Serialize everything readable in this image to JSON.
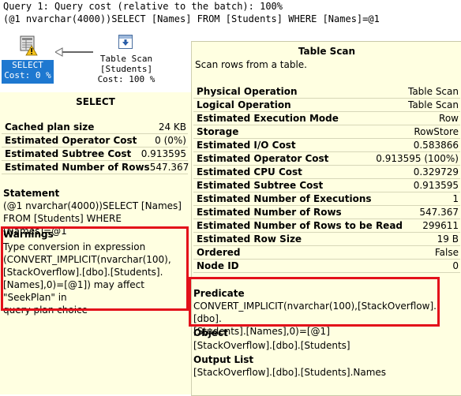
{
  "header": {
    "line1": "Query 1: Query cost (relative to the batch): 100%",
    "line2": "(@1 nvarchar(4000))SELECT [Names] FROM [Students] WHERE [Names]=@1"
  },
  "plan": {
    "select_node": {
      "label1": "SELECT",
      "label2": "Cost: 0 %",
      "icon": "select-warning-icon"
    },
    "scan_node": {
      "line1": "Table Scan",
      "line2": "[Students]",
      "line3": "Cost: 100 %",
      "icon": "table-scan-icon"
    }
  },
  "select_tooltip": {
    "title": "SELECT",
    "rows": [
      {
        "label": "Cached plan size",
        "value": "24 KB"
      },
      {
        "label": "Estimated Operator Cost",
        "value": "0 (0%)"
      },
      {
        "label": "Estimated Subtree Cost",
        "value": "0.913595"
      },
      {
        "label": "Estimated Number of Rows",
        "value": "547.367"
      }
    ],
    "statement_title": "Statement",
    "statement_line1": "(@1 nvarchar(4000))SELECT [Names]",
    "statement_line2": "FROM [Students] WHERE [Names]=@1",
    "warnings_title": "Warnings",
    "warnings_lines": [
      "Type conversion in expression",
      "(CONVERT_IMPLICIT(nvarchar(100),",
      "[StackOverflow].[dbo].[Students].",
      "[Names],0)=[@1]) may affect \"SeekPlan\" in",
      "query plan choice"
    ]
  },
  "scan_tooltip": {
    "title": "Table Scan",
    "description": "Scan rows from a table.",
    "rows": [
      {
        "label": "Physical Operation",
        "value": "Table Scan"
      },
      {
        "label": "Logical Operation",
        "value": "Table Scan"
      },
      {
        "label": "Estimated Execution Mode",
        "value": "Row"
      },
      {
        "label": "Storage",
        "value": "RowStore"
      },
      {
        "label": "Estimated I/O Cost",
        "value": "0.583866"
      },
      {
        "label": "Estimated Operator Cost",
        "value": "0.913595 (100%)"
      },
      {
        "label": "Estimated CPU Cost",
        "value": "0.329729"
      },
      {
        "label": "Estimated Subtree Cost",
        "value": "0.913595"
      },
      {
        "label": "Estimated Number of Executions",
        "value": "1"
      },
      {
        "label": "Estimated Number of Rows",
        "value": "547.367"
      },
      {
        "label": "Estimated Number of Rows to be Read",
        "value": "299611"
      },
      {
        "label": "Estimated Row Size",
        "value": "19 B"
      },
      {
        "label": "Ordered",
        "value": "False"
      },
      {
        "label": "Node ID",
        "value": "0"
      }
    ],
    "predicate_title": "Predicate",
    "predicate_line1": "CONVERT_IMPLICIT(nvarchar(100),[StackOverflow].[dbo].",
    "predicate_line2": "[Students].[Names],0)=[@1]",
    "object_title": "Object",
    "object_value": "[StackOverflow].[dbo].[Students]",
    "output_title": "Output List",
    "output_value": "[StackOverflow].[dbo].[Students].Names"
  },
  "colors": {
    "tooltip_bg": "#ffffe1",
    "highlight_red": "#e3101a",
    "select_bg": "#1e78d0"
  }
}
